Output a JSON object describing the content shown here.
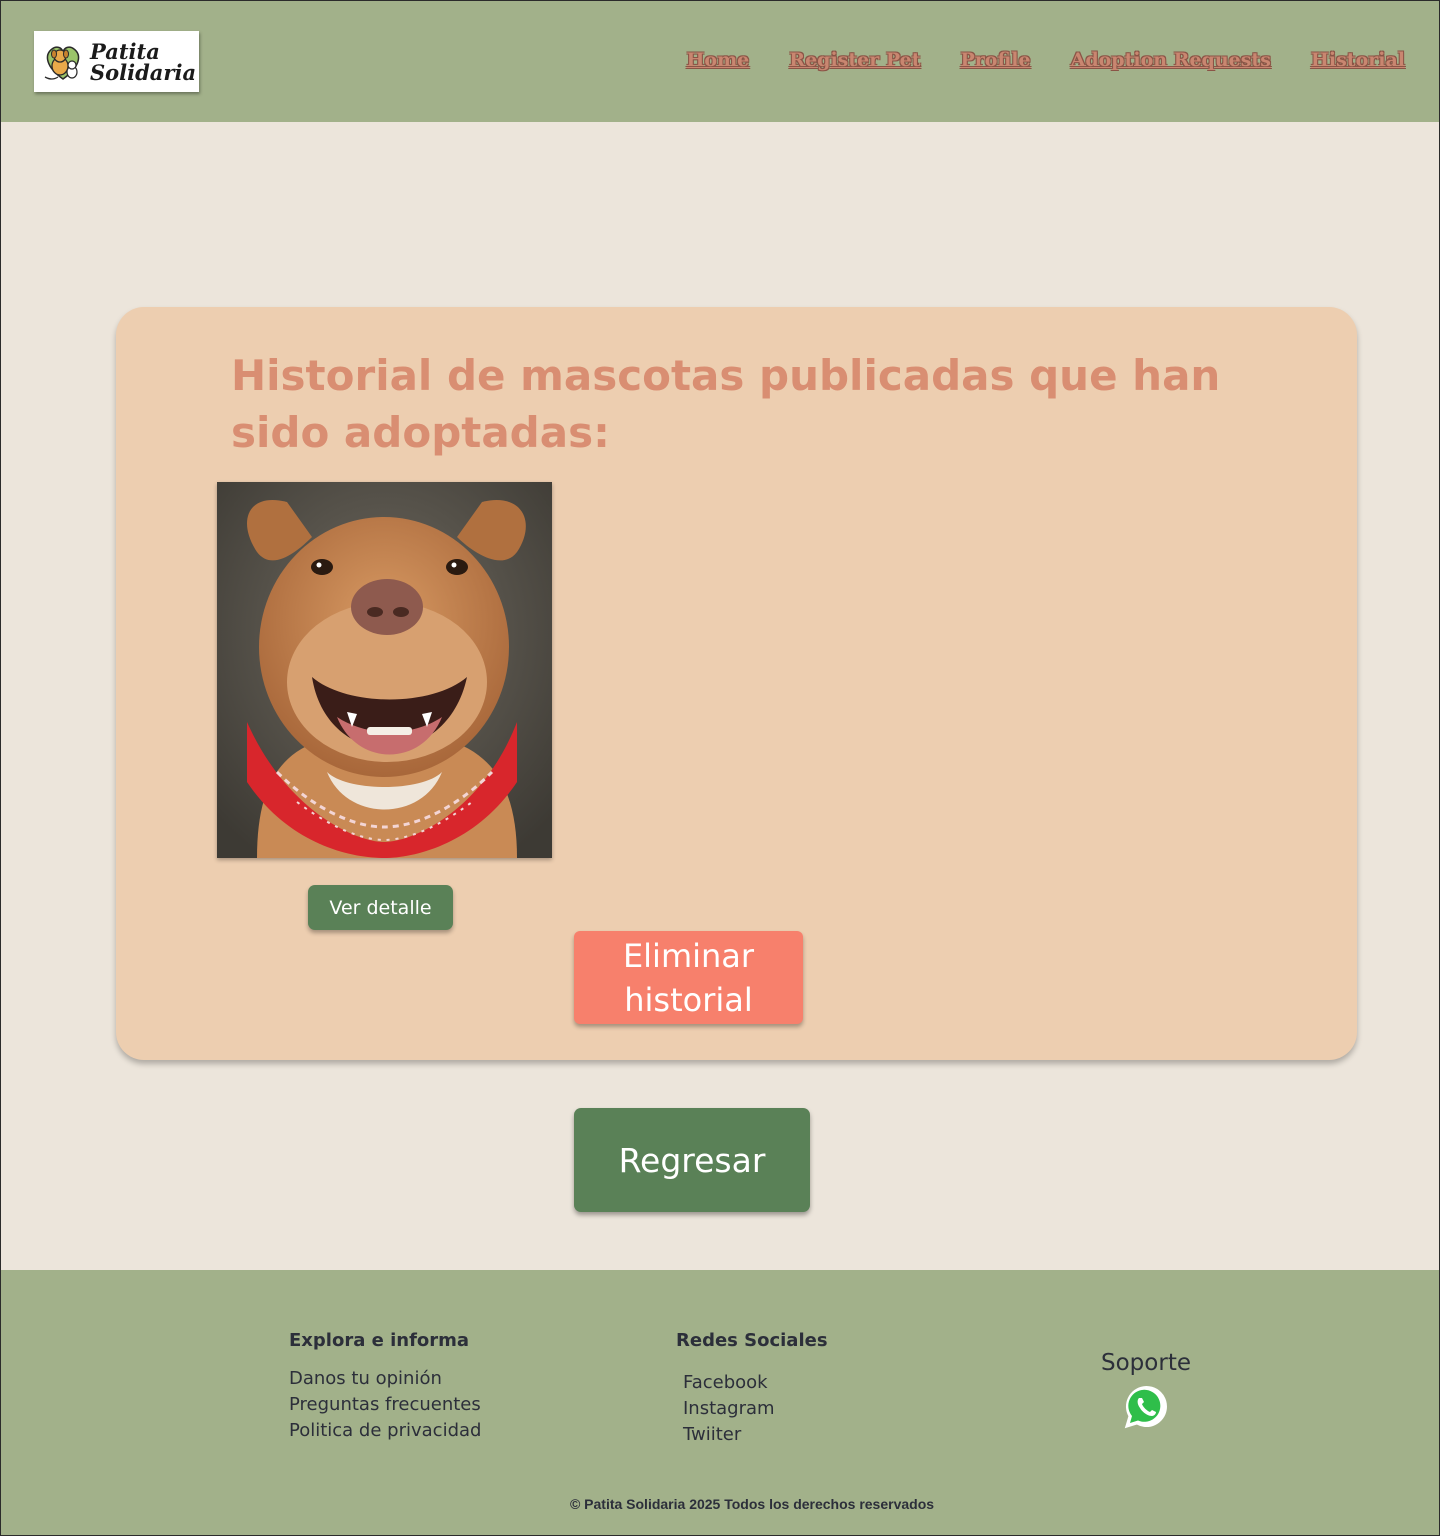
{
  "header": {
    "logo_line1": "Patita",
    "logo_line2": "Solidaria",
    "nav": [
      "Home",
      "Register Pet",
      "Profile",
      "Adoption Requests",
      "Historial"
    ]
  },
  "main": {
    "title": "Historial de mascotas publicadas que han sido adoptadas:",
    "detail_button": "Ver detalle",
    "delete_button": "Eliminar historial",
    "back_button": "Regresar"
  },
  "footer": {
    "col1": {
      "heading": "Explora e informa",
      "links": [
        "Danos tu opinión",
        "Preguntas frecuentes",
        "Politica de privacidad"
      ]
    },
    "col2": {
      "heading": "Redes Sociales",
      "links": [
        "Facebook",
        "Instagram",
        "Twiiter"
      ]
    },
    "support": "Soporte",
    "copyright": "© Patita Solidaria 2025 Todos los derechos reservados"
  },
  "colors": {
    "header_bg": "#A2B18A",
    "page_bg": "#ECE5DB",
    "card_bg": "#EDCEB0",
    "title": "#D98E72",
    "primary_button": "#5A8157",
    "danger_button": "#F7806C"
  },
  "icons": [
    "logo-icon",
    "whatsapp-icon"
  ]
}
